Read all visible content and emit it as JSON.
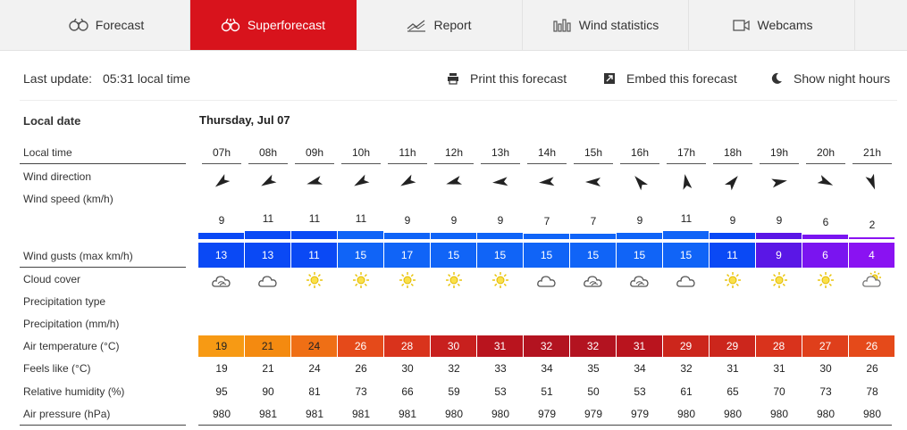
{
  "tabs": [
    {
      "label": "Forecast",
      "icon": "binoculars-icon",
      "active": false
    },
    {
      "label": "Superforecast",
      "icon": "binoculars-icon",
      "active": true
    },
    {
      "label": "Report",
      "icon": "report-chart-icon",
      "active": false
    },
    {
      "label": "Wind statistics",
      "icon": "bar-chart-icon",
      "active": false
    },
    {
      "label": "Webcams",
      "icon": "camera-icon",
      "active": false
    }
  ],
  "info": {
    "last_update_label": "Last update:",
    "last_update_value": "05:31 local time"
  },
  "actions": [
    {
      "label": "Print this forecast",
      "icon": "printer-icon"
    },
    {
      "label": "Embed this forecast",
      "icon": "embed-icon"
    },
    {
      "label": "Show night hours",
      "icon": "moon-icon"
    }
  ],
  "labels": {
    "local_date": "Local date",
    "local_time": "Local time",
    "wind_direction": "Wind direction",
    "wind_speed": "Wind speed  (km/h)",
    "wind_gusts": "Wind gusts  (max km/h)",
    "cloud_cover": "Cloud cover",
    "precip_type": "Precipitation type",
    "precip": "Precipitation  (mm/h)",
    "air_temp": "Air temperature  (°C)",
    "feels_like": "Feels like  (°C)",
    "humidity": "Relative humidity  (%)",
    "pressure": "Air pressure  (hPa)"
  },
  "date": "Thursday, Jul 07",
  "colors": {
    "brand": "#d8131c",
    "gust_blue": "#0a49f5",
    "gust_violet": "#5a17e6",
    "gust_purple": "#7a14f0"
  },
  "hours": [
    {
      "time": "07h",
      "wind_dir": 232,
      "wind_speed": "9",
      "gust": "13",
      "gust_color": "#0a49f5",
      "cloud": "cloud-sun",
      "temp": "19",
      "temp_color": "#f79a14",
      "temp_dark": true,
      "feels": "19",
      "rh": "95",
      "press": "980"
    },
    {
      "time": "08h",
      "wind_dir": 240,
      "wind_speed": "11",
      "gust": "13",
      "gust_color": "#0a49f5",
      "cloud": "cloud",
      "temp": "21",
      "temp_color": "#f48a10",
      "temp_dark": true,
      "feels": "21",
      "rh": "90",
      "press": "981"
    },
    {
      "time": "09h",
      "wind_dir": 255,
      "wind_speed": "11",
      "gust": "11",
      "gust_color": "#0a49f5",
      "cloud": "sun",
      "temp": "24",
      "temp_color": "#ef6f15",
      "temp_dark": true,
      "feels": "24",
      "rh": "81",
      "press": "981"
    },
    {
      "time": "10h",
      "wind_dir": 240,
      "wind_speed": "11",
      "gust": "15",
      "gust_color": "#1064f7",
      "cloud": "sun",
      "temp": "26",
      "temp_color": "#e54a1a",
      "temp_dark": false,
      "feels": "26",
      "rh": "73",
      "press": "981"
    },
    {
      "time": "11h",
      "wind_dir": 240,
      "wind_speed": "9",
      "gust": "17",
      "gust_color": "#1064f7",
      "cloud": "sun",
      "temp": "28",
      "temp_color": "#d9331c",
      "temp_dark": false,
      "feels": "30",
      "rh": "66",
      "press": "981"
    },
    {
      "time": "12h",
      "wind_dir": 255,
      "wind_speed": "9",
      "gust": "15",
      "gust_color": "#1064f7",
      "cloud": "sun",
      "temp": "30",
      "temp_color": "#c8201e",
      "temp_dark": false,
      "feels": "32",
      "rh": "59",
      "press": "980"
    },
    {
      "time": "13h",
      "wind_dir": 265,
      "wind_speed": "9",
      "gust": "15",
      "gust_color": "#1064f7",
      "cloud": "sun",
      "temp": "31",
      "temp_color": "#b9141e",
      "temp_dark": false,
      "feels": "33",
      "rh": "53",
      "press": "980"
    },
    {
      "time": "14h",
      "wind_dir": 265,
      "wind_speed": "7",
      "gust": "15",
      "gust_color": "#1064f7",
      "cloud": "cloud",
      "temp": "32",
      "temp_color": "#b31320",
      "temp_dark": false,
      "feels": "34",
      "rh": "51",
      "press": "979"
    },
    {
      "time": "15h",
      "wind_dir": 270,
      "wind_speed": "7",
      "gust": "15",
      "gust_color": "#1064f7",
      "cloud": "cloud-sun",
      "temp": "32",
      "temp_color": "#b31320",
      "temp_dark": false,
      "feels": "35",
      "rh": "50",
      "press": "979"
    },
    {
      "time": "16h",
      "wind_dir": 320,
      "wind_speed": "9",
      "gust": "15",
      "gust_color": "#1064f7",
      "cloud": "cloud-sun",
      "temp": "31",
      "temp_color": "#b9141e",
      "temp_dark": false,
      "feels": "34",
      "rh": "53",
      "press": "979"
    },
    {
      "time": "17h",
      "wind_dir": 350,
      "wind_speed": "11",
      "gust": "15",
      "gust_color": "#1064f7",
      "cloud": "cloud",
      "temp": "29",
      "temp_color": "#cc261c",
      "temp_dark": false,
      "feels": "32",
      "rh": "61",
      "press": "980"
    },
    {
      "time": "18h",
      "wind_dir": 40,
      "wind_speed": "9",
      "gust": "11",
      "gust_color": "#0a49f5",
      "cloud": "sun",
      "temp": "29",
      "temp_color": "#cc261c",
      "temp_dark": false,
      "feels": "31",
      "rh": "65",
      "press": "980"
    },
    {
      "time": "19h",
      "wind_dir": 80,
      "wind_speed": "9",
      "gust": "9",
      "gust_color": "#5a17e6",
      "cloud": "sun",
      "temp": "28",
      "temp_color": "#d9331c",
      "temp_dark": false,
      "feels": "31",
      "rh": "70",
      "press": "980"
    },
    {
      "time": "20h",
      "wind_dir": 115,
      "wind_speed": "6",
      "gust": "6",
      "gust_color": "#7a14f0",
      "cloud": "sun",
      "temp": "27",
      "temp_color": "#df3f1b",
      "temp_dark": false,
      "feels": "30",
      "rh": "73",
      "press": "980"
    },
    {
      "time": "21h",
      "wind_dir": 160,
      "wind_speed": "2",
      "gust": "4",
      "gust_color": "#8a12f2",
      "cloud": "cloud-sun-light",
      "temp": "26",
      "temp_color": "#e54a1a",
      "temp_dark": false,
      "feels": "26",
      "rh": "78",
      "press": "980"
    }
  ]
}
